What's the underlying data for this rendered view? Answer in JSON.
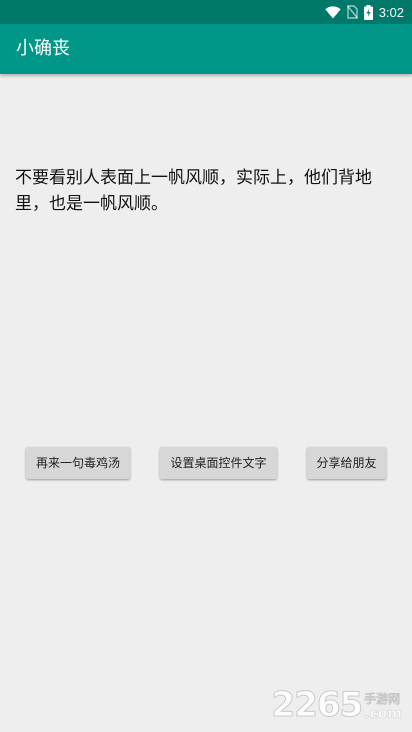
{
  "status_bar": {
    "time": "3:02",
    "icons": [
      "wifi-icon",
      "no-sim-icon",
      "battery-icon"
    ],
    "color": "#00796b"
  },
  "app_bar": {
    "title": "小确丧",
    "color": "#009688"
  },
  "main": {
    "quote": "不要看别人表面上一帆风顺，实际上，他们背地里，也是一帆风顺。"
  },
  "buttons": {
    "another": "再来一句毒鸡汤",
    "set_widget": "设置桌面控件文字",
    "share": "分享给朋友"
  },
  "watermark": {
    "number": "2265",
    "site_cn": "手游网",
    "site_com": ".com"
  }
}
